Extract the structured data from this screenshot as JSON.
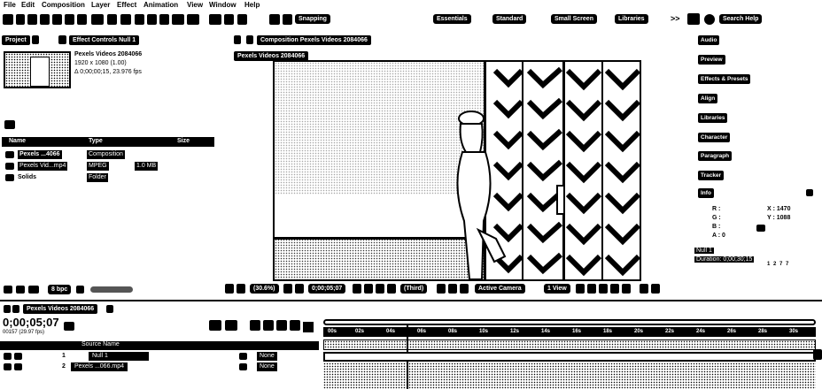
{
  "menu": [
    "File",
    "Edit",
    "Composition",
    "Layer",
    "Effect",
    "Animation",
    "View",
    "Window",
    "Help"
  ],
  "toolbar": {
    "snapping": "Snapping",
    "workspaces": [
      "Essentials",
      "Standard",
      "Small Screen",
      "Libraries"
    ],
    "more": ">>",
    "search_placeholder": "Search Help"
  },
  "project": {
    "tab_label": "Project",
    "effect_controls_tab": "Effect Controls Null 1",
    "item_name": "Pexels Videos 2084066",
    "item_res": "1920 x 1080 (1.00)",
    "item_duration": "Δ 0;00;00;15, 23.976 fps",
    "columns": [
      "Name",
      "Type",
      "Size"
    ],
    "rows": [
      {
        "name": "Pexels ...4066",
        "type": "Composition",
        "size": ""
      },
      {
        "name": "Pexels Vid...mp4",
        "type": "MPEG",
        "size": "1.0 MB"
      },
      {
        "name": "Solids",
        "type": "Folder",
        "size": ""
      }
    ],
    "bpc": "8 bpc"
  },
  "composition": {
    "tab_label": "Composition Pexels Videos 2084066",
    "sub_tab": "Pexels Videos 2084066",
    "zoom": "(30.6%)",
    "timecode": "0;00;05;07",
    "resolution": "(Third)",
    "camera": "Active Camera",
    "view": "1 View"
  },
  "right_panel": {
    "items": [
      "Audio",
      "Preview",
      "Effects & Presets",
      "Align",
      "Libraries",
      "Character",
      "Paragraph",
      "Tracker",
      "Info"
    ],
    "info_r": "R :",
    "info_g": "G :",
    "info_b": "B :",
    "info_a": "A : 0",
    "info_x": "X : 1470",
    "info_y": "Y : 1088",
    "null_label": "Null 1",
    "duration": "Duration: 0;00;30;15",
    "coords": "1 2 7 7"
  },
  "timeline": {
    "tab_label": "Pexels Videos 2084066",
    "timecode": "0;00;05;07",
    "fps_label": "00157 (29.97 fps)",
    "source_name_header": "Source Name",
    "layers": [
      {
        "num": "1",
        "name": "Null 1",
        "parent": "None"
      },
      {
        "num": "2",
        "name": "Pexels ...066.mp4",
        "parent": "None"
      }
    ],
    "ruler": [
      "00s",
      "02s",
      "04s",
      "06s",
      "08s",
      "10s",
      "12s",
      "14s",
      "16s",
      "18s",
      "20s",
      "22s",
      "24s",
      "26s",
      "28s",
      "30s"
    ]
  }
}
